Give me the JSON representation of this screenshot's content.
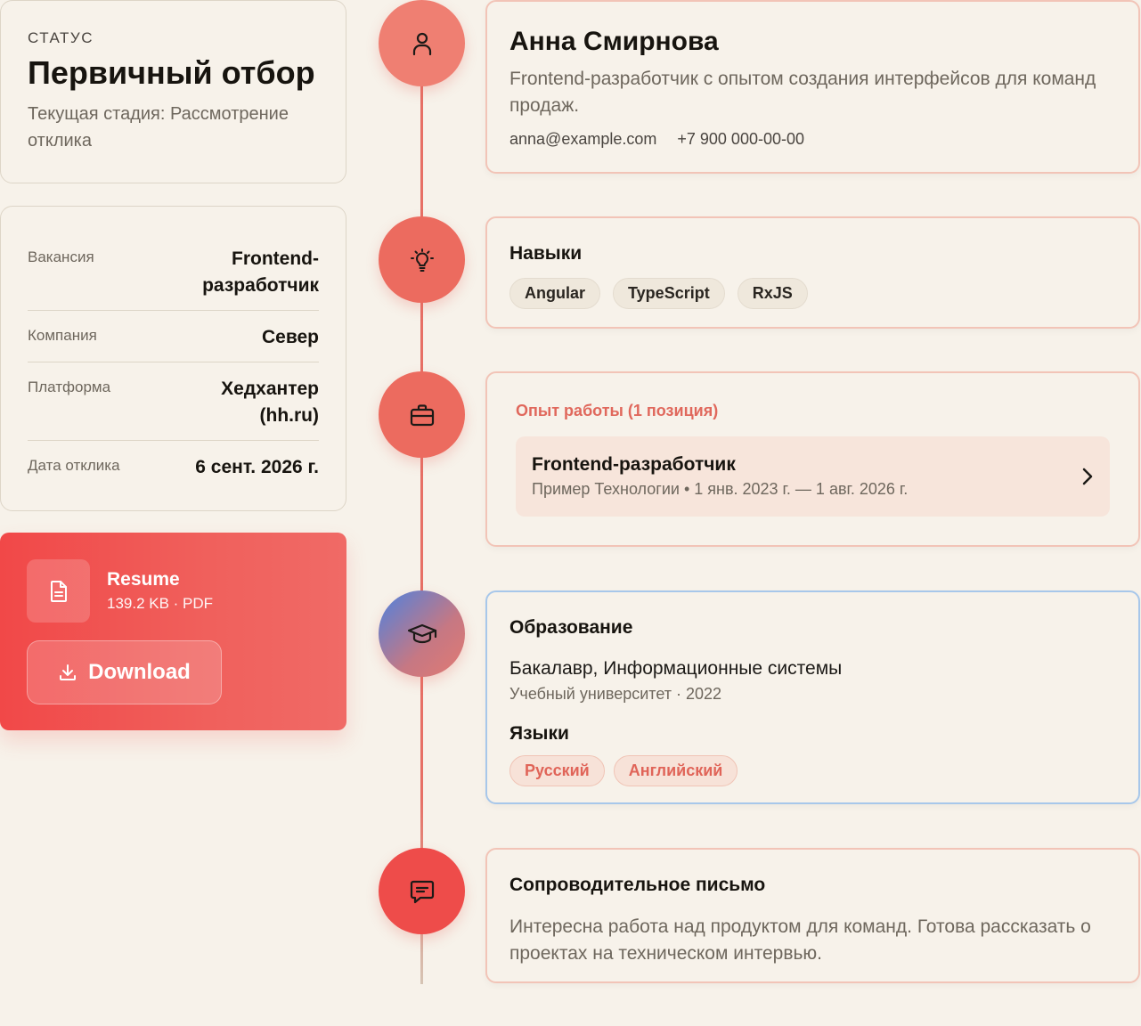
{
  "status": {
    "label": "СТАТУС",
    "title": "Первичный отбор",
    "subtitle": "Текущая стадия: Рассмотрение отклика"
  },
  "info": {
    "rows": [
      {
        "key": "Вакансия",
        "value": "Frontend-разработчик"
      },
      {
        "key": "Компания",
        "value": "Север"
      },
      {
        "key": "Платформа",
        "value": "Хедхантер (hh.ru)"
      },
      {
        "key": "Дата отклика",
        "value": "6 сент. 2026 г."
      }
    ]
  },
  "resume": {
    "name": "Resume",
    "meta": "139.2 KB · PDF",
    "download_label": "Download"
  },
  "candidate": {
    "name": "Анна Смирнова",
    "description": "Frontend-разработчик с опытом создания интерфейсов для команд продаж.",
    "email": "anna@example.com",
    "phone": "+7 900 000-00-00"
  },
  "skills": {
    "title": "Навыки",
    "items": [
      "Angular",
      "TypeScript",
      "RxJS"
    ]
  },
  "experience": {
    "title": "Опыт работы (1 позиция)",
    "items": [
      {
        "position": "Frontend-разработчик",
        "details": "Пример Технологии • 1 янв. 2023 г. — 1 авг. 2026 г."
      }
    ]
  },
  "education": {
    "title": "Образование",
    "degree": "Бакалавр, Информационные системы",
    "details": "Учебный университет · 2022",
    "languages_title": "Языки",
    "languages": [
      "Русский",
      "Английский"
    ]
  },
  "cover_letter": {
    "title": "Сопроводительное письмо",
    "text": "Интересна работа над продуктом для команд. Готова рассказать о проектах на техническом интервью."
  },
  "colors": {
    "accent": "#ec6b5f",
    "background": "#f7f2ea",
    "resume_gradient_start": "#f14848",
    "education_node": "#4d82e0"
  }
}
